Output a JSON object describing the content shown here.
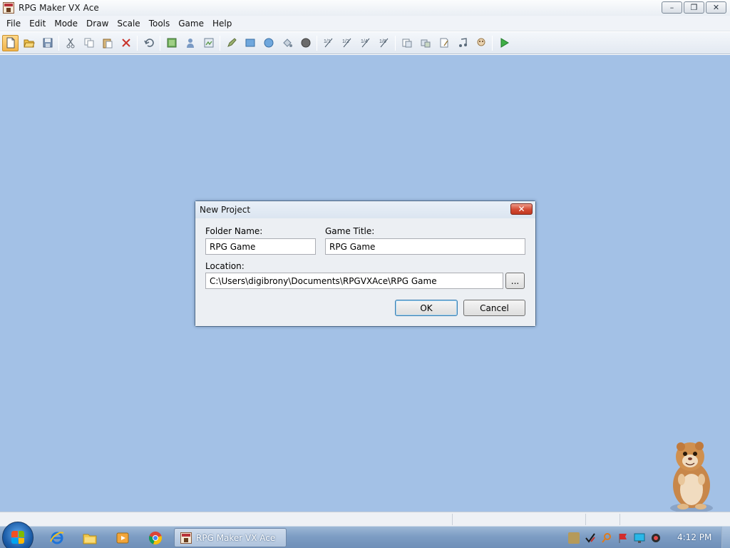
{
  "window": {
    "title": "RPG Maker VX Ace",
    "controls": {
      "minimize": "–",
      "restore": "❐",
      "close": "✕"
    }
  },
  "menu": [
    "File",
    "Edit",
    "Mode",
    "Draw",
    "Scale",
    "Tools",
    "Game",
    "Help"
  ],
  "toolbar": {
    "groups": [
      [
        "new-project-icon",
        "open-project-icon",
        "save-project-icon"
      ],
      [
        "cut-icon",
        "copy-icon",
        "paste-icon",
        "delete-icon"
      ],
      [
        "undo-icon"
      ],
      [
        "map-layer-icon",
        "event-layer-icon",
        "region-layer-icon"
      ],
      [
        "pencil-icon",
        "rectangle-icon",
        "ellipse-icon",
        "flood-fill-icon",
        "shadow-pen-icon"
      ],
      [
        "scale-1-1-icon",
        "scale-1-2-icon",
        "scale-1-4-icon",
        "scale-1-8-icon"
      ],
      [
        "database-icon",
        "resource-manager-icon",
        "script-editor-icon",
        "sound-test-icon",
        "character-generator-icon"
      ],
      [
        "playtest-icon"
      ]
    ],
    "scale_labels": [
      "1/1",
      "1/2",
      "1/4",
      "1/8"
    ]
  },
  "dialog": {
    "title": "New Project",
    "close": "✕",
    "folder_name_label": "Folder Name:",
    "folder_name_value": "RPG Game",
    "game_title_label": "Game Title:",
    "game_title_value": "RPG Game",
    "location_label": "Location:",
    "location_value": "C:\\Users\\digibrony\\Documents\\RPGVXAce\\RPG Game",
    "browse_label": "...",
    "ok_label": "OK",
    "cancel_label": "Cancel"
  },
  "taskbar": {
    "active_app": "RPG Maker VX Ace",
    "pinned": [
      "internet-explorer-icon",
      "file-explorer-icon",
      "media-player-icon",
      "chrome-icon"
    ],
    "tray": [
      "tray-app-icon",
      "tray-checkmark-icon",
      "tray-search-icon",
      "tray-flag-icon",
      "tray-monitor-icon",
      "tray-volume-icon"
    ],
    "clock": "4:12 PM"
  },
  "colors": {
    "desktop": "#a3c1e6",
    "dialog_body": "#eceff3",
    "close_red": "#d34a34",
    "highlight": "#f2b44a"
  }
}
